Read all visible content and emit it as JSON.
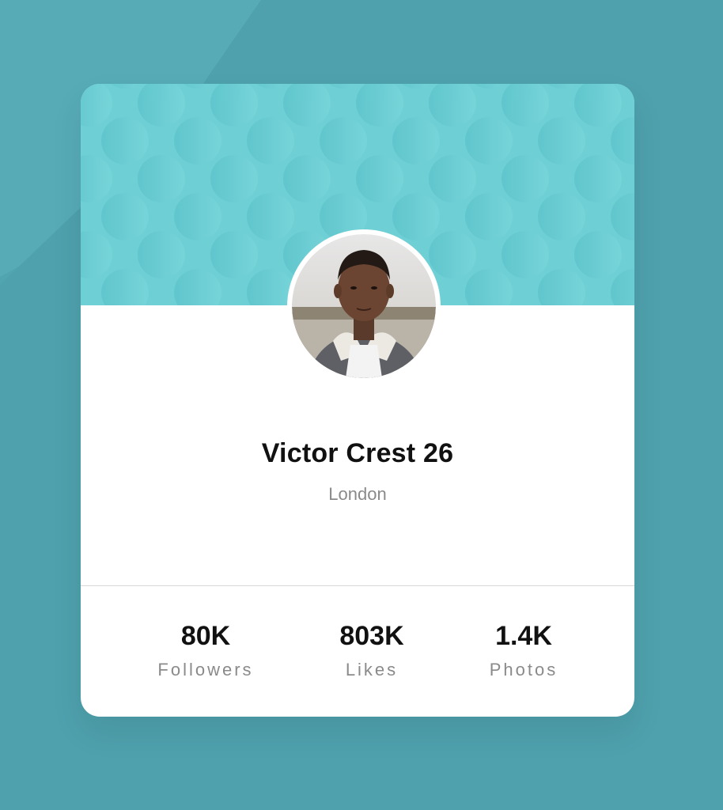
{
  "profile": {
    "name": "Victor Crest 26",
    "location": "London",
    "avatar_alt": "profile-photo"
  },
  "stats": [
    {
      "value": "80K",
      "label": "Followers"
    },
    {
      "value": "803K",
      "label": "Likes"
    },
    {
      "value": "1.4K",
      "label": "Photos"
    }
  ],
  "colors": {
    "background": "#4ea1ad",
    "header": "#6ecfd4",
    "card": "#ffffff",
    "text_primary": "#111111",
    "text_secondary": "#8a8a8a"
  }
}
